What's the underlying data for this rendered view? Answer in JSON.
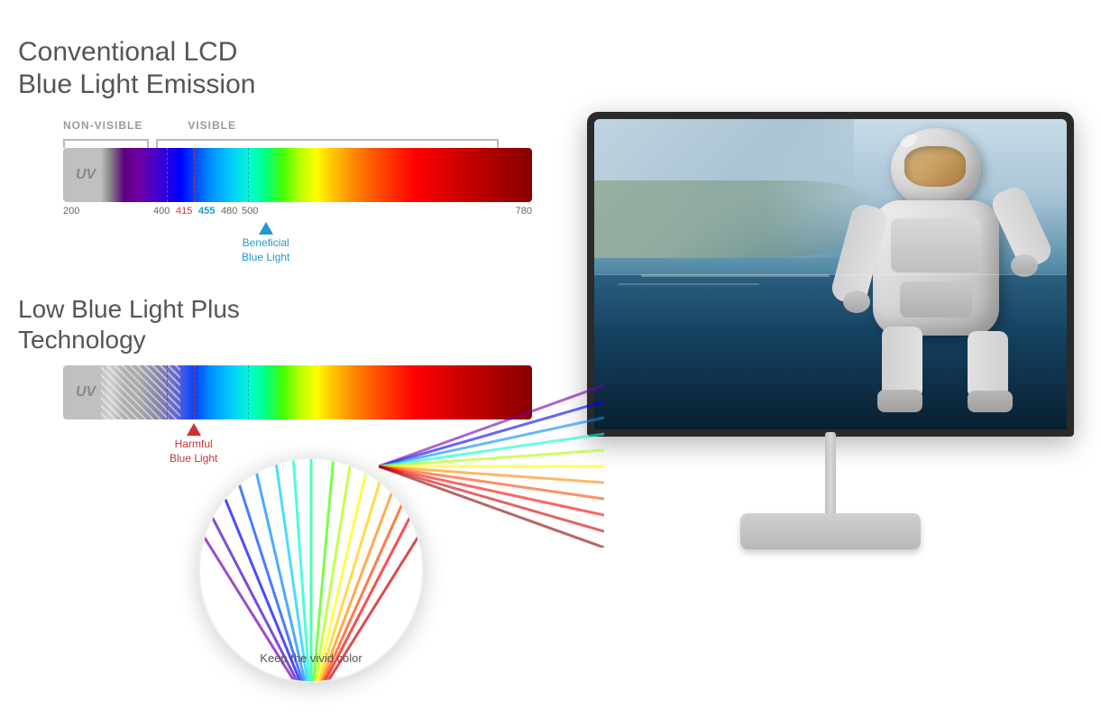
{
  "page": {
    "background": "#ffffff"
  },
  "title": {
    "line1": "Conventional LCD",
    "line2": "Blue Light Emission"
  },
  "spectrum_chart_1": {
    "label_nonvisible": "NON-VISIBLE",
    "label_visible": "VISIBLE",
    "uv_label": "UV",
    "nm_values": [
      "200",
      "400",
      "415",
      "455",
      "480",
      "500",
      "780"
    ],
    "nm_415": "415",
    "nm_455": "455",
    "nm_480": "480",
    "beneficial_label_line1": "Beneficial",
    "beneficial_label_line2": "Blue Light"
  },
  "lbl_section": {
    "title_line1": "Low Blue Light Plus",
    "title_line2": "Technology",
    "uv_label": "UV",
    "harmful_label_line1": "Harmful",
    "harmful_label_line2": "Blue Light",
    "keep_vivid_text": "Keep the vivid color"
  },
  "monitor": {
    "alt": "BenQ monitor displaying astronaut in space"
  }
}
